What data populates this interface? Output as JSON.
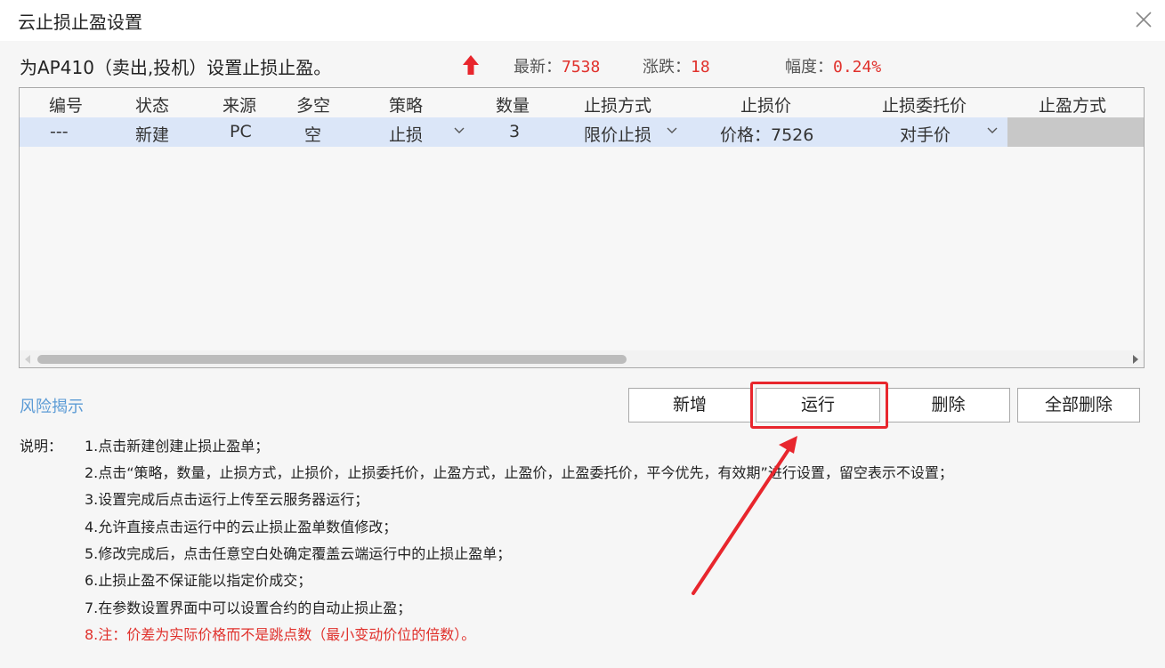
{
  "window": {
    "title": "云止损止盈设置"
  },
  "info": {
    "contract_desc": "为AP410（卖出,投机）设置止损止盈。",
    "latest_label": "最新：",
    "latest_value": "7538",
    "change_label": "涨跌：",
    "change_value": "18",
    "range_label": "幅度：",
    "range_value": "0.24%",
    "trend_icon": "up-arrow-icon",
    "up_color": "#e0312c"
  },
  "table": {
    "columns": [
      "编号",
      "状态",
      "来源",
      "多空",
      "策略",
      "数量",
      "止损方式",
      "止损价",
      "止损委托价",
      "止盈方式"
    ],
    "rows": [
      {
        "id": "---",
        "status": "新建",
        "source": "PC",
        "direction": "空",
        "strategy": "止损",
        "quantity": "3",
        "stop_method": "限价止损",
        "stop_price": "价格：7526",
        "stop_order_price": "对手价",
        "take_profit_method": ""
      }
    ]
  },
  "risk_link": "风险揭示",
  "buttons": {
    "add": "新增",
    "run": "运行",
    "delete": "删除",
    "delete_all": "全部删除"
  },
  "notes": {
    "label": "说明：",
    "items": [
      "1.点击新建创建止损止盈单；",
      "2.点击“策略，数量，止损方式，止损价，止损委托价，止盈方式，止盈价，止盈委托价，平今优先，有效期”进行设置，留空表示不设置；",
      "3.设置完成后点击运行上传至云服务器运行；",
      "4.允许直接点击运行中的云止损止盈单数值修改；",
      "5.修改完成后，点击任意空白处确定覆盖云端运行中的止损止盈单；",
      "6.止损止盈不保证能以指定价成交；",
      "7.在参数设置界面中可以设置合约的自动止损止盈；",
      "8.注：价差为实际价格而不是跳点数（最小变动价位的倍数）。"
    ]
  },
  "annotation": {
    "color": "#e8262d"
  }
}
